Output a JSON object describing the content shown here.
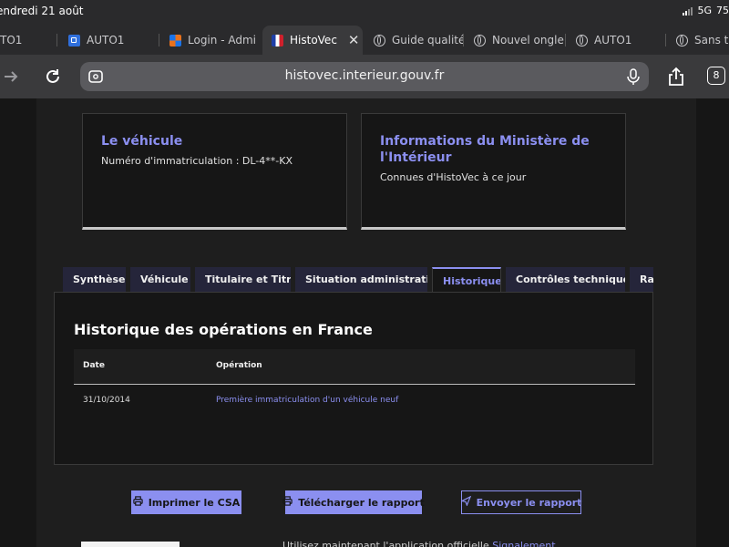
{
  "status_bar": {
    "time": "endredi 21 août",
    "network": "5G",
    "battery": "75"
  },
  "browser_tabs": [
    {
      "label": "TO1",
      "icon": "none"
    },
    {
      "label": "AUTO1",
      "icon": "auto1-favicon"
    },
    {
      "label": "Login - Admi",
      "icon": "login-favicon"
    },
    {
      "label": "HistoVec",
      "icon": "histovec-favicon",
      "active": true
    },
    {
      "label": "Guide qualité",
      "icon": "globe-icon"
    },
    {
      "label": "Nouvel ongle",
      "icon": "globe-icon"
    },
    {
      "label": "AUTO1",
      "icon": "globe-icon"
    },
    {
      "label": "Sans t",
      "icon": "globe-icon"
    }
  ],
  "toolbar": {
    "url": "histovec.interieur.gouv.fr",
    "tab_count": "8"
  },
  "cards": {
    "vehicle": {
      "title": "Le véhicule",
      "text": "Numéro d'immatriculation : DL-4**-KX"
    },
    "ministry": {
      "title_line1": "Informations du Ministère de",
      "title_line2": "l'Intérieur",
      "text": "Connues d'HistoVec à ce jour"
    }
  },
  "nav_tabs": [
    "Synthèse",
    "Véhicule",
    "Titulaire et Titre",
    "Situation administrative",
    "Historique",
    "Contrôles techniques",
    "Rapport"
  ],
  "selected_tab": "Historique",
  "history": {
    "title": "Historique des opérations en France",
    "columns": [
      "Date",
      "Opération"
    ],
    "rows": [
      {
        "date": "31/10/2014",
        "operation": "Première immatriculation d'un véhicule neuf"
      }
    ]
  },
  "actions": {
    "print": "Imprimer le CSA",
    "download": "Télécharger le rapport",
    "send": "Envoyer le rapport"
  },
  "footer": {
    "text": "Utilisez maintenant l'application officielle ",
    "link": "Signalement"
  },
  "colors": {
    "accent": "#8b8ff0",
    "background": "#161616"
  }
}
